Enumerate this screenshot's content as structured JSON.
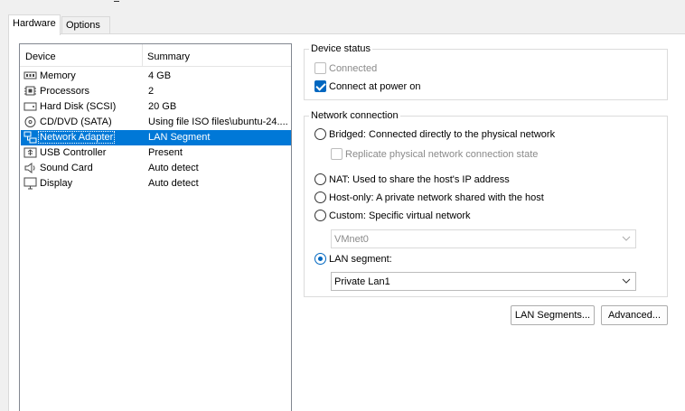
{
  "tabs": [
    {
      "label": "Hardware",
      "active": true
    },
    {
      "label": "Options",
      "active": false
    }
  ],
  "device_list": {
    "headers": {
      "device": "Device",
      "summary": "Summary"
    },
    "rows": [
      {
        "name": "Memory",
        "summary": "4 GB",
        "icon": "memory-icon"
      },
      {
        "name": "Processors",
        "summary": "2",
        "icon": "processor-icon"
      },
      {
        "name": "Hard Disk (SCSI)",
        "summary": "20 GB",
        "icon": "hard-disk-icon"
      },
      {
        "name": "CD/DVD (SATA)",
        "summary": "Using file ISO files\\ubuntu-24....",
        "icon": "cd-dvd-icon"
      },
      {
        "name": "Network Adapter",
        "summary": "LAN Segment",
        "icon": "network-adapter-icon",
        "selected": true
      },
      {
        "name": "USB Controller",
        "summary": "Present",
        "icon": "usb-icon"
      },
      {
        "name": "Sound Card",
        "summary": "Auto detect",
        "icon": "speaker-icon"
      },
      {
        "name": "Display",
        "summary": "Auto detect",
        "icon": "monitor-icon"
      }
    ]
  },
  "device_status": {
    "legend": "Device status",
    "connected": {
      "label": "Connected",
      "checked": false,
      "disabled": true
    },
    "connect_at_power_on": {
      "label": "Connect at power on",
      "checked": true
    }
  },
  "network_connection": {
    "legend": "Network connection",
    "bridged": "Bridged: Connected directly to the physical network",
    "replicate": "Replicate physical network connection state",
    "nat": "NAT: Used to share the host's IP address",
    "host_only": "Host-only: A private network shared with the host",
    "custom": "Custom: Specific virtual network",
    "custom_value": "VMnet0",
    "lan_segment": "LAN segment:",
    "lan_value": "Private Lan1",
    "selected": "lan_segment"
  },
  "buttons": {
    "lan_segments": "LAN Segments...",
    "advanced": "Advanced..."
  },
  "colors": {
    "selection": "#0078d7",
    "accent": "#0067c0"
  }
}
